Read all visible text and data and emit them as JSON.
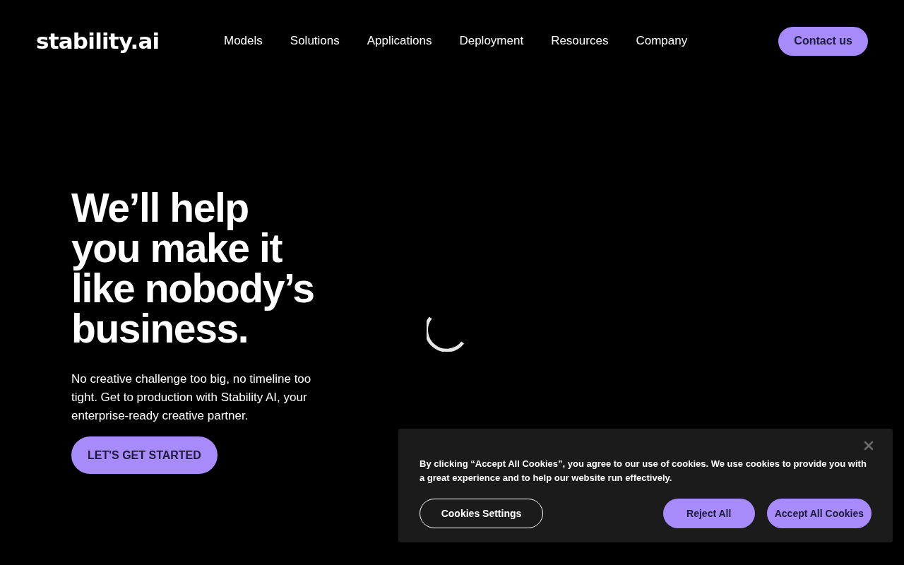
{
  "header": {
    "logo": "stability.ai",
    "nav": [
      "Models",
      "Solutions",
      "Applications",
      "Deployment",
      "Resources",
      "Company"
    ],
    "cta": "Contact us"
  },
  "hero": {
    "heading_lines": [
      "We’ll help",
      "you make it",
      "like nobody’s",
      "business."
    ],
    "body": "No creative challenge too big, no timeline too tight. Get to production with Stability AI, your enterprise-ready creative partner.",
    "button": "LET'S GET STARTED"
  },
  "cookie_banner": {
    "message": "By clicking “Accept All Cookies”, you agree to our use of cookies. We use cookies to provide you with a great experience and to help our website run effectively.",
    "buttons": [
      {
        "label": "Cookies Settings",
        "kind": "outline"
      },
      {
        "label": "Reject All",
        "kind": "filled"
      },
      {
        "label": "Accept All Cookies",
        "kind": "filled"
      }
    ]
  }
}
